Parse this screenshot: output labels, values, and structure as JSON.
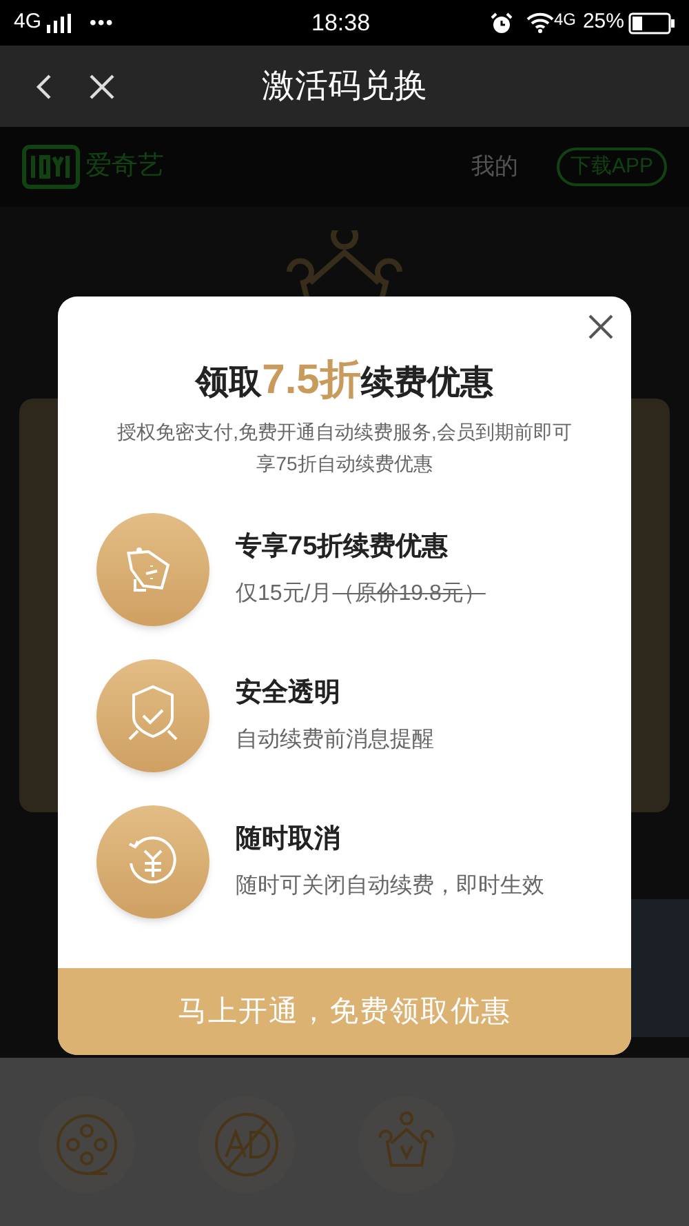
{
  "status_bar": {
    "network": "4G",
    "dots": "•••",
    "time": "18:38",
    "network_right": "4G",
    "battery": "25%"
  },
  "nav": {
    "title": "激活码兑换"
  },
  "site_header": {
    "brand": "爱奇艺",
    "mine": "我的",
    "download": "下载APP"
  },
  "popup": {
    "title_parts": [
      {
        "text": "领取",
        "highlight": false
      },
      {
        "text": "7.5折",
        "highlight": true
      },
      {
        "text": "续费优惠",
        "highlight": false
      }
    ],
    "subtitle": "授权免密支付,免费开通自动续费服务,会员到期前即可享75折自动续费优惠",
    "features": [
      {
        "kind": "tag",
        "title": "专享75折续费优惠",
        "text": "仅15元/月",
        "struck": "（原价19.8元）"
      },
      {
        "kind": "shield",
        "title": "安全透明",
        "text": "自动续费前消息提醒"
      },
      {
        "kind": "refund",
        "title": "随时取消",
        "text": "随时可关闭自动续费，即时生效"
      }
    ],
    "button": "马上开通，免费领取优惠"
  },
  "bottom_icons": [
    {
      "kind": "film"
    },
    {
      "kind": "no-ad"
    },
    {
      "kind": "crown"
    }
  ]
}
